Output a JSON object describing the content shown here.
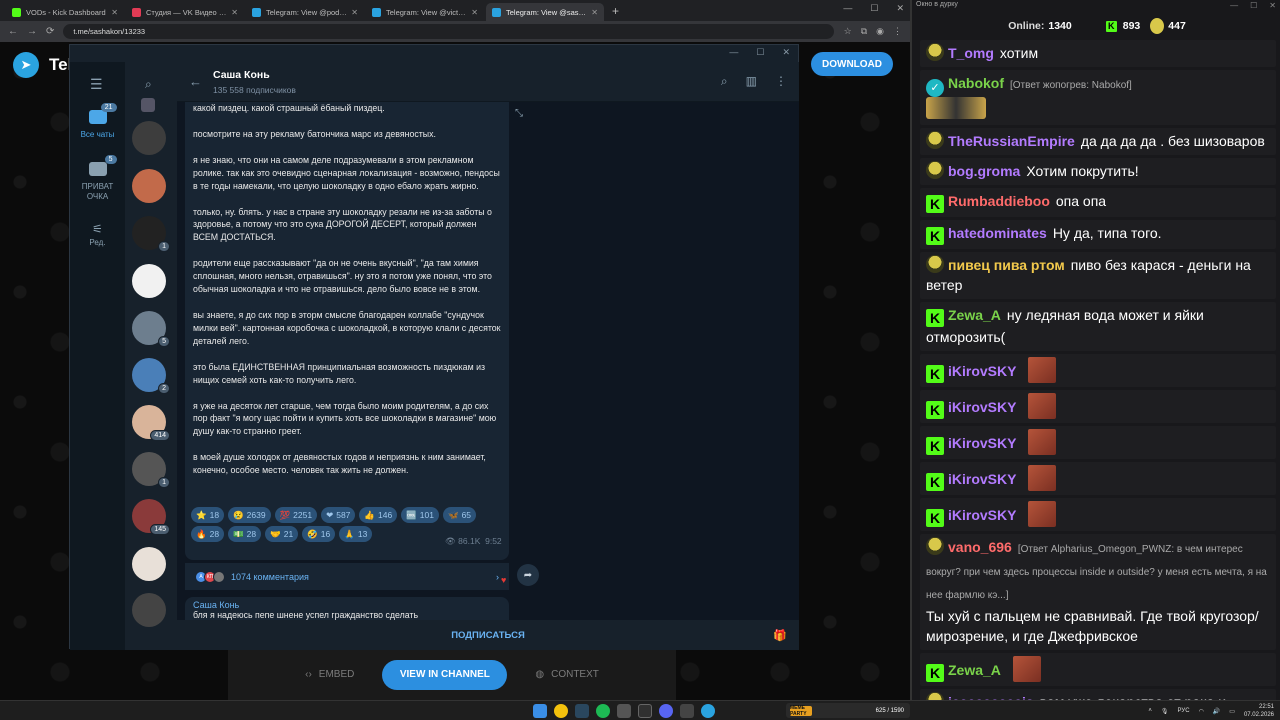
{
  "browser": {
    "tabs": [
      {
        "label": "VODs - Kick Dashboard",
        "color": "#53fc18"
      },
      {
        "label": "Студия — VK Видео Live",
        "color": "#e23b55"
      },
      {
        "label": "Telegram: View @podcos_club",
        "color": "#2aa3e0"
      },
      {
        "label": "Telegram: View @victorstepany",
        "color": "#2aa3e0"
      },
      {
        "label": "Telegram: View @sashakon",
        "color": "#2aa3e0"
      }
    ],
    "url": "t.me/sashakon/13233"
  },
  "page": {
    "logo_text": "Telegram",
    "download_label": "DOWNLOAD",
    "embed_label": "EMBED",
    "view_in_channel_label": "VIEW IN CHANNEL",
    "context_label": "CONTEXT"
  },
  "telegram": {
    "folders": [
      {
        "label": "Все чаты",
        "badge": "21"
      },
      {
        "label": "ПРИВАТ ОЧКА",
        "badge": "5"
      },
      {
        "label": "Ред.",
        "badge": ""
      }
    ],
    "chat_badges": [
      "",
      "",
      "1",
      "",
      "5",
      "2",
      "414",
      "1",
      "145",
      "",
      ""
    ],
    "channel_title": "Саша Конь",
    "channel_subtitle": "135 558 подписчиков",
    "message_paragraphs": [
      "какой пиздец. какой страшный ёбаный пиздец.",
      "посмотрите на эту рекламу батончика марс из девяностых.",
      "я не знаю, что они на самом деле подразумевали в этом рекламном ролике. так как это очевидно сценарная локализация - возможно, пендосы в те годы намекали, что целую шоколадку в одно ебало жрать жирно.",
      "только, ну. блять. у нас в стране эту шоколадку резали не из-за заботы о здоровье, а потому что это сука ДОРОГОЙ ДЕСЕРТ, который должен ВСЕМ ДОСТАТЬСЯ.",
      "родители еще рассказывают \"да он не очень вкусный\", \"да там химия сплошная, много нельзя, отравишься\". ну это я потом уже понял, что это обычная шоколадка и что не отравишься. дело было вовсе не в этом.",
      "вы знаете, я до сих пор в эторм смысле благодарен коллабе \"сундучок милки вей\". картонная коробочка с шоколадкой, в которую клали с десяток деталей лего.",
      "это была ЕДИНСТВЕННАЯ принципиальная возможность пиздюкам из нищих семей хоть как-то получить лего.",
      "я уже на десяток лет старше, чем тогда было моим родителям, а до сих пор факт \"я могу щас пойти и купить хоть все шоколадки в магазине\" мою душу как-то странно греет.",
      "в моей душе холодок от девяностых годов и неприязнь к ним занимает, конечно, особое место. человек так жить не должен."
    ],
    "reactions": [
      {
        "emoji": "⭐",
        "count": "18"
      },
      {
        "emoji": "😢",
        "count": "2639"
      },
      {
        "emoji": "💯",
        "count": "2251"
      },
      {
        "emoji": "❤",
        "count": "587"
      },
      {
        "emoji": "👍",
        "count": "146"
      },
      {
        "emoji": "🆒",
        "count": "101"
      },
      {
        "emoji": "🦋",
        "count": "65"
      },
      {
        "emoji": "🔥",
        "count": "28"
      },
      {
        "emoji": "💵",
        "count": "28"
      },
      {
        "emoji": "🤝",
        "count": "21"
      },
      {
        "emoji": "🤣",
        "count": "16"
      },
      {
        "emoji": "🙏",
        "count": "13"
      }
    ],
    "views": "86.1K",
    "time": "9:52",
    "comments_label": "1074 комментария",
    "comment_avatar_initials": [
      "A",
      "КП"
    ],
    "next_author": "Саша Конь",
    "next_text": "бля я надеюсь пепе шнене успел гражданство сделать",
    "subscribe_label": "ПОДПИСАТЬСЯ"
  },
  "chat": {
    "window_title": "Окно в дурку",
    "online_label": "Online:",
    "online_count": "1340",
    "stat_k": "893",
    "stat_pepe": "447",
    "messages": [
      {
        "badge": "pepe",
        "user": "T_omg",
        "color": "#b37bff",
        "text": "хотим"
      },
      {
        "badge": "verified",
        "user": "Nabokof",
        "color": "#7ad34a",
        "reply": "[Ответ жопогрев: Nabokof]",
        "text": ""
      },
      {
        "badge": "pepe",
        "user": "TheRussianEmpire",
        "color": "#b37bff",
        "text": "да да да да  . без шизоваров"
      },
      {
        "badge": "pepe",
        "user": "bog.groma",
        "color": "#b37bff",
        "text": "Хотим покрутить!"
      },
      {
        "badge": "k",
        "user": "Rumbaddieboo",
        "color": "#ff6b6b",
        "text": "опа опа"
      },
      {
        "badge": "k",
        "user": "hatedominates",
        "color": "#b37bff",
        "text": "Ну да, типа того."
      },
      {
        "badge": "pepe",
        "user": "пивец пива ртом",
        "color": "#f2c94c",
        "text": "пиво без карася - деньги на ветер"
      },
      {
        "badge": "k",
        "user": "Zewa_A",
        "color": "#7ad34a",
        "text": "ну ледяная вода может и яйки отморозить("
      },
      {
        "badge": "k",
        "user": "iKirovSKY",
        "color": "#b37bff",
        "text": "",
        "emote": true
      },
      {
        "badge": "k",
        "user": "iKirovSKY",
        "color": "#b37bff",
        "text": "",
        "emote": true
      },
      {
        "badge": "k",
        "user": "iKirovSKY",
        "color": "#b37bff",
        "text": "",
        "emote": true
      },
      {
        "badge": "k",
        "user": "iKirovSKY",
        "color": "#b37bff",
        "text": "",
        "emote": true
      },
      {
        "badge": "k",
        "user": "iKirovSKY",
        "color": "#b37bff",
        "text": "",
        "emote": true
      },
      {
        "badge": "pepe",
        "user": "vano_696",
        "color": "#ff6b6b",
        "reply": "[Ответ Alpharius_Omegon_PWNZ: в чем интерес вокруг? при чем здесь процессы inside и outside? у меня есть мечта, я на нее фармлю кэ...]",
        "text": "Ты хуй с пальцем не сравнивай. Где твой кругозор/мирозрение, и где Джефривское"
      },
      {
        "badge": "k",
        "user": "Zewa_A",
        "color": "#7ad34a",
        "text": "",
        "emote": true
      },
      {
        "badge": "pepe",
        "user": "jeeeeeeeeeja",
        "color": "#b37bff",
        "text": "вам уже лекарства от рака и ожирения показали, а вы в биохак не верите"
      }
    ]
  },
  "taskbar": {
    "widget_label": "MEME PARTY",
    "widget_value": "625 / 1590",
    "lang": "РУС",
    "time": "22:51",
    "date": "07.02.2026"
  }
}
